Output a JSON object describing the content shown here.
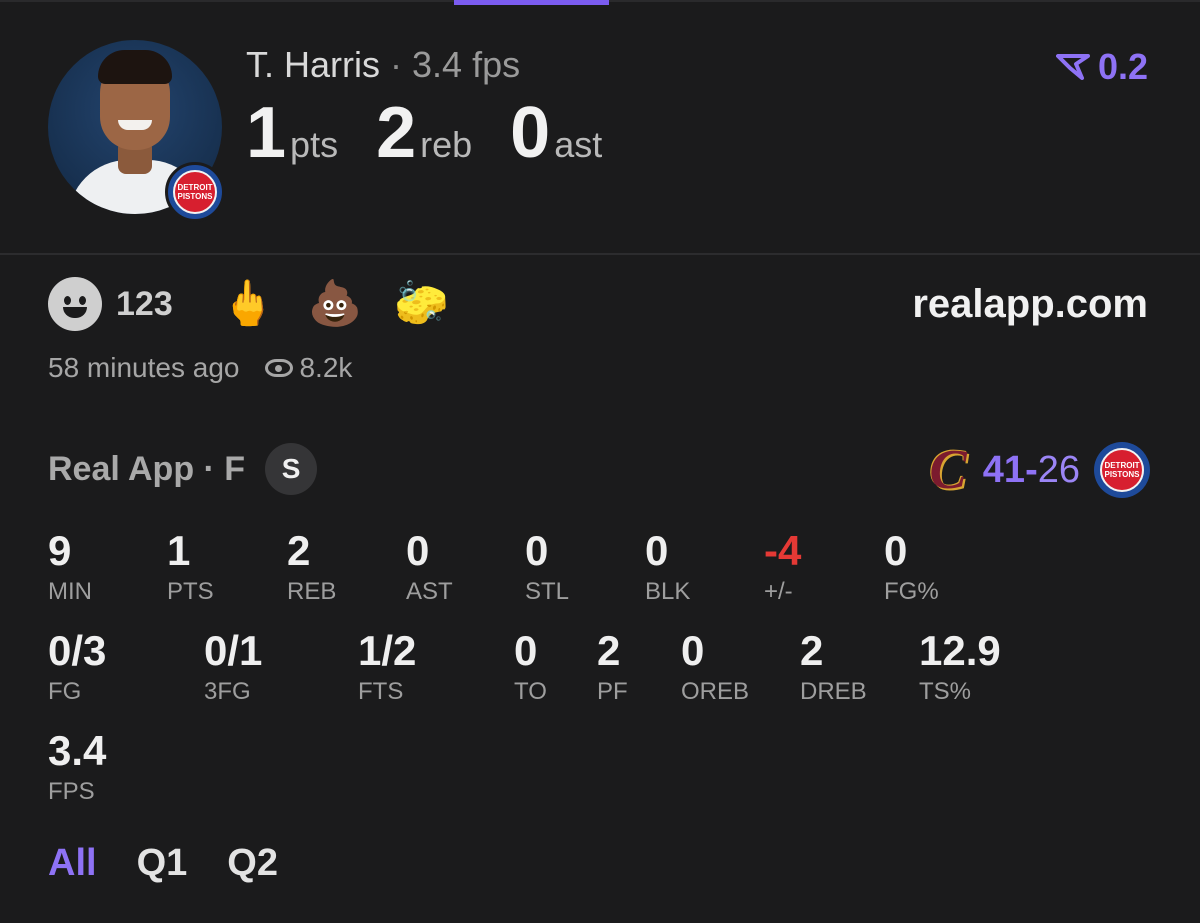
{
  "header": {
    "player_name": "T. Harris",
    "separator": "·",
    "fps_text": "3.4 fps",
    "rating_value": "0.2",
    "team_badge_text": "DETROIT PISTONS",
    "stats": [
      {
        "value": "1",
        "unit": "pts"
      },
      {
        "value": "2",
        "unit": "reb"
      },
      {
        "value": "0",
        "unit": "ast"
      }
    ]
  },
  "reactions": {
    "count": "123",
    "emojis": [
      "🖕",
      "💩",
      "🧽"
    ],
    "site": "realapp.com",
    "time_ago": "58 minutes ago",
    "views": "8.2k"
  },
  "game": {
    "league": "Real App · F",
    "starter_badge": "S",
    "home_score": "41",
    "dash": "-",
    "away_score": "26",
    "home_logo": "C",
    "away_badge_text": "DETROIT PISTONS"
  },
  "stats_row1": [
    {
      "value": "9",
      "label": "MIN"
    },
    {
      "value": "1",
      "label": "PTS"
    },
    {
      "value": "2",
      "label": "REB"
    },
    {
      "value": "0",
      "label": "AST"
    },
    {
      "value": "0",
      "label": "STL"
    },
    {
      "value": "0",
      "label": "BLK"
    },
    {
      "value": "-4",
      "label": "+/-"
    },
    {
      "value": "0",
      "label": "FG%"
    }
  ],
  "stats_row2": [
    {
      "value": "0/3",
      "label": "FG"
    },
    {
      "value": "0/1",
      "label": "3FG"
    },
    {
      "value": "1/2",
      "label": "FTS"
    },
    {
      "value": "0",
      "label": "TO"
    },
    {
      "value": "2",
      "label": "PF"
    },
    {
      "value": "0",
      "label": "OREB"
    },
    {
      "value": "2",
      "label": "DREB"
    },
    {
      "value": "12.9",
      "label": "TS%"
    }
  ],
  "stats_row3": [
    {
      "value": "3.4",
      "label": "FPS"
    }
  ],
  "tabs": [
    "All",
    "Q1",
    "Q2"
  ],
  "colors": {
    "accent": "#8e72f5",
    "negative": "#e53935",
    "background": "#1b1b1c"
  }
}
